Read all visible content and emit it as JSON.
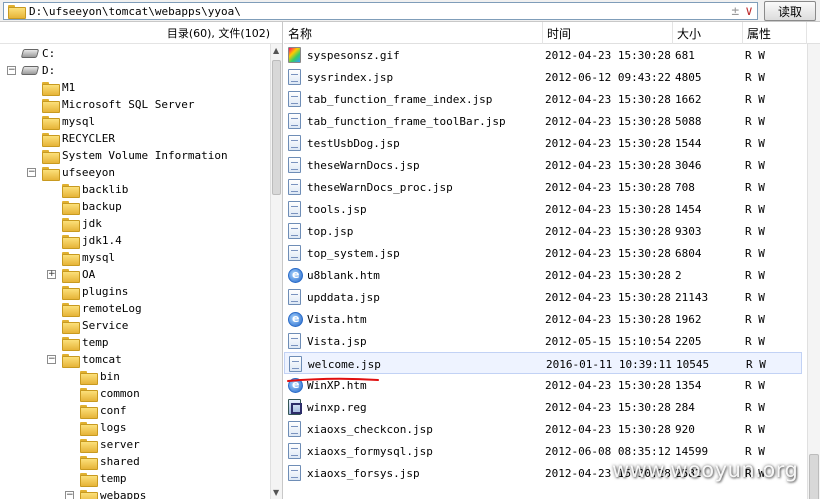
{
  "path_bar": {
    "path": "D:\\ufseeyon\\tomcat\\webapps\\yyoa\\",
    "up_glyph": "±",
    "dropdown_glyph": "∨",
    "read_button": "读取"
  },
  "tree_panel": {
    "summary": "目录(60), 文件(102)",
    "nodes": [
      {
        "label": "C:",
        "icon": "drive-icon",
        "expander": ""
      },
      {
        "label": "D:",
        "icon": "drive-icon",
        "expander": "−"
      },
      {
        "label": "M1",
        "icon": "folder-icon",
        "expander": ""
      },
      {
        "label": "Microsoft SQL Server",
        "icon": "folder-icon",
        "expander": ""
      },
      {
        "label": "mysql",
        "icon": "folder-icon",
        "expander": ""
      },
      {
        "label": "RECYCLER",
        "icon": "folder-icon",
        "expander": ""
      },
      {
        "label": "System Volume Information",
        "icon": "folder-icon",
        "expander": ""
      },
      {
        "label": "ufseeyon",
        "icon": "folder-icon",
        "expander": "−"
      },
      {
        "label": "backlib",
        "icon": "folder-icon",
        "expander": ""
      },
      {
        "label": "backup",
        "icon": "folder-icon",
        "expander": ""
      },
      {
        "label": "jdk",
        "icon": "folder-icon",
        "expander": ""
      },
      {
        "label": "jdk1.4",
        "icon": "folder-icon",
        "expander": ""
      },
      {
        "label": "mysql",
        "icon": "folder-icon",
        "expander": ""
      },
      {
        "label": "OA",
        "icon": "folder-icon",
        "expander": "+"
      },
      {
        "label": "plugins",
        "icon": "folder-icon",
        "expander": ""
      },
      {
        "label": "remoteLog",
        "icon": "folder-icon",
        "expander": ""
      },
      {
        "label": "Service",
        "icon": "folder-icon",
        "expander": ""
      },
      {
        "label": "temp",
        "icon": "folder-icon",
        "expander": ""
      },
      {
        "label": "tomcat",
        "icon": "folder-icon",
        "expander": "−"
      },
      {
        "label": "bin",
        "icon": "folder-icon",
        "expander": ""
      },
      {
        "label": "common",
        "icon": "folder-icon",
        "expander": ""
      },
      {
        "label": "conf",
        "icon": "folder-icon",
        "expander": ""
      },
      {
        "label": "logs",
        "icon": "folder-icon",
        "expander": ""
      },
      {
        "label": "server",
        "icon": "folder-icon",
        "expander": ""
      },
      {
        "label": "shared",
        "icon": "folder-icon",
        "expander": ""
      },
      {
        "label": "temp",
        "icon": "folder-icon",
        "expander": ""
      },
      {
        "label": "webapps",
        "icon": "folder-icon",
        "expander": "−"
      }
    ]
  },
  "file_list": {
    "columns": [
      "名称",
      "时间",
      "大小",
      "属性"
    ],
    "rows": [
      {
        "name": "syspesonsz.gif",
        "time": "2012-04-23 15:30:28",
        "size": "681",
        "attr": "R W",
        "icon": "gif"
      },
      {
        "name": "sysrindex.jsp",
        "time": "2012-06-12 09:43:22",
        "size": "4805",
        "attr": "R W",
        "icon": "jsp"
      },
      {
        "name": "tab_function_frame_index.jsp",
        "time": "2012-04-23 15:30:28",
        "size": "1662",
        "attr": "R W",
        "icon": "jsp"
      },
      {
        "name": "tab_function_frame_toolBar.jsp",
        "time": "2012-04-23 15:30:28",
        "size": "5088",
        "attr": "R W",
        "icon": "jsp"
      },
      {
        "name": "testUsbDog.jsp",
        "time": "2012-04-23 15:30:28",
        "size": "1544",
        "attr": "R W",
        "icon": "jsp"
      },
      {
        "name": "theseWarnDocs.jsp",
        "time": "2012-04-23 15:30:28",
        "size": "3046",
        "attr": "R W",
        "icon": "jsp"
      },
      {
        "name": "theseWarnDocs_proc.jsp",
        "time": "2012-04-23 15:30:28",
        "size": "708",
        "attr": "R W",
        "icon": "jsp"
      },
      {
        "name": "tools.jsp",
        "time": "2012-04-23 15:30:28",
        "size": "1454",
        "attr": "R W",
        "icon": "jsp"
      },
      {
        "name": "top.jsp",
        "time": "2012-04-23 15:30:28",
        "size": "9303",
        "attr": "R W",
        "icon": "jsp"
      },
      {
        "name": "top_system.jsp",
        "time": "2012-04-23 15:30:28",
        "size": "6804",
        "attr": "R W",
        "icon": "jsp"
      },
      {
        "name": "u8blank.htm",
        "time": "2012-04-23 15:30:28",
        "size": "2",
        "attr": "R W",
        "icon": "htm"
      },
      {
        "name": "upddata.jsp",
        "time": "2012-04-23 15:30:28",
        "size": "21143",
        "attr": "R W",
        "icon": "jsp"
      },
      {
        "name": "Vista.htm",
        "time": "2012-04-23 15:30:28",
        "size": "1962",
        "attr": "R W",
        "icon": "htm"
      },
      {
        "name": "Vista.jsp",
        "time": "2012-05-15 15:10:54",
        "size": "2205",
        "attr": "R W",
        "icon": "jsp"
      },
      {
        "name": "welcome.jsp",
        "time": "2016-01-11 10:39:11",
        "size": "10545",
        "attr": "R W",
        "icon": "jsp",
        "selected": true
      },
      {
        "name": "WinXP.htm",
        "time": "2012-04-23 15:30:28",
        "size": "1354",
        "attr": "R W",
        "icon": "htm"
      },
      {
        "name": "winxp.reg",
        "time": "2012-04-23 15:30:28",
        "size": "284",
        "attr": "R W",
        "icon": "reg"
      },
      {
        "name": "xiaoxs_checkcon.jsp",
        "time": "2012-04-23 15:30:28",
        "size": "920",
        "attr": "R W",
        "icon": "jsp"
      },
      {
        "name": "xiaoxs_formysql.jsp",
        "time": "2012-06-08 08:35:12",
        "size": "14599",
        "attr": "R W",
        "icon": "jsp"
      },
      {
        "name": "xiaoxs_forsys.jsp",
        "time": "2012-04-23 15:30:28",
        "size": "2582",
        "attr": "R W",
        "icon": "jsp"
      }
    ]
  },
  "watermark": "www.wooyun.org",
  "colors": {
    "selection": "#eef3ff",
    "annotation_underline": "#e01010"
  }
}
